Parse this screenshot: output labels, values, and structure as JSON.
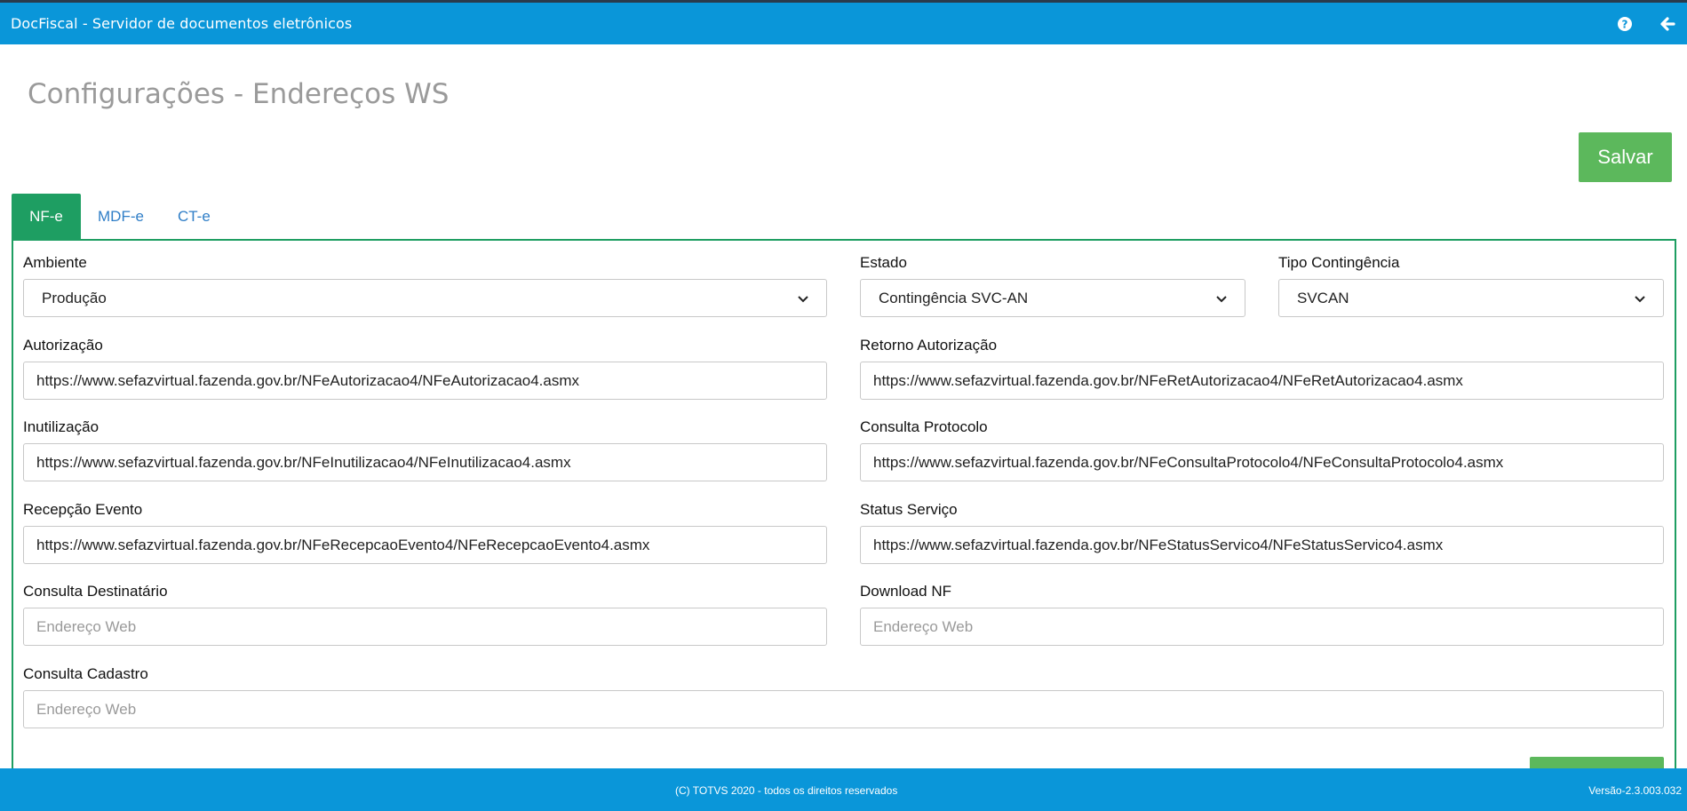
{
  "app": {
    "title": "DocFiscal - Servidor de documentos eletrônicos",
    "header_icons": [
      "help-circle-icon",
      "arrow-left-icon"
    ]
  },
  "page": {
    "title": "Configurações - Endereços WS",
    "save_label": "Salvar"
  },
  "tabs": [
    {
      "label": "NF-e",
      "active": true
    },
    {
      "label": "MDF-e",
      "active": false
    },
    {
      "label": "CT-e",
      "active": false
    }
  ],
  "form": {
    "ambiente": {
      "label": "Ambiente",
      "value": "Produção"
    },
    "estado": {
      "label": "Estado",
      "value": "Contingência SVC-AN"
    },
    "tipo_contingencia": {
      "label": "Tipo Contingência",
      "value": "SVCAN"
    },
    "autorizacao": {
      "label": "Autorização",
      "value": "https://www.sefazvirtual.fazenda.gov.br/NFeAutorizacao4/NFeAutorizacao4.asmx"
    },
    "retorno_autorizacao": {
      "label": "Retorno Autorização",
      "value": "https://www.sefazvirtual.fazenda.gov.br/NFeRetAutorizacao4/NFeRetAutorizacao4.asmx"
    },
    "inutilizacao": {
      "label": "Inutilização",
      "value": "https://www.sefazvirtual.fazenda.gov.br/NFeInutilizacao4/NFeInutilizacao4.asmx"
    },
    "consulta_protocolo": {
      "label": "Consulta Protocolo",
      "value": "https://www.sefazvirtual.fazenda.gov.br/NFeConsultaProtocolo4/NFeConsultaProtocolo4.asmx"
    },
    "recepcao_evento": {
      "label": "Recepção Evento",
      "value": "https://www.sefazvirtual.fazenda.gov.br/NFeRecepcaoEvento4/NFeRecepcaoEvento4.asmx"
    },
    "status_servico": {
      "label": "Status Serviço",
      "value": "https://www.sefazvirtual.fazenda.gov.br/NFeStatusServico4/NFeStatusServico4.asmx"
    },
    "consulta_destinatario": {
      "label": "Consulta Destinatário",
      "placeholder": "Endereço Web"
    },
    "download_nf": {
      "label": "Download NF",
      "placeholder": "Endereço Web"
    },
    "consulta_cadastro": {
      "label": "Consulta Cadastro",
      "placeholder": "Endereço Web"
    }
  },
  "footer": {
    "copyright": "(C) TOTVS 2020 - todos os direitos reservados",
    "version": "Versão-2.3.003.032"
  },
  "colors": {
    "header_blue": "#0a96d9",
    "tab_active_green": "#1e9e62",
    "save_green": "#5cb85c",
    "title_gray": "#9a9a9a"
  }
}
